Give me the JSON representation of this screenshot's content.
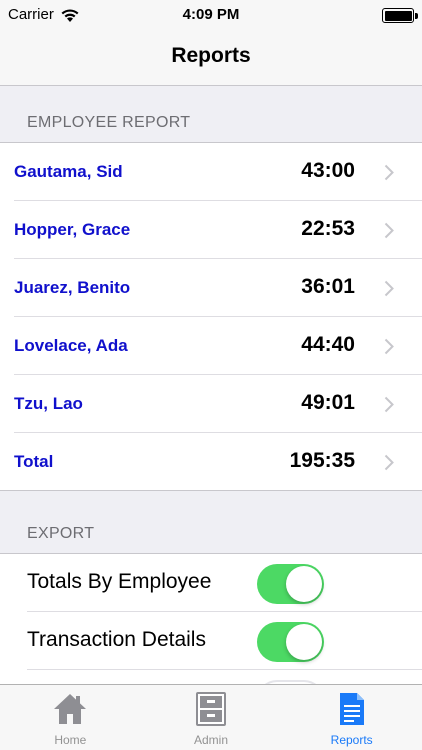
{
  "status_bar": {
    "carrier": "Carrier",
    "time": "4:09 PM"
  },
  "nav": {
    "title": "Reports"
  },
  "employee_report": {
    "header": "EMPLOYEE REPORT",
    "rows": [
      {
        "name": "Gautama, Sid",
        "value": "43:00"
      },
      {
        "name": "Hopper, Grace",
        "value": "22:53"
      },
      {
        "name": "Juarez, Benito",
        "value": "36:01"
      },
      {
        "name": "Lovelace, Ada",
        "value": "44:40"
      },
      {
        "name": "Tzu, Lao",
        "value": "49:01"
      },
      {
        "name": "Total",
        "value": "195:35"
      }
    ]
  },
  "export": {
    "header": "EXPORT",
    "rows": [
      {
        "label": "Totals By Employee",
        "enabled": true
      },
      {
        "label": "Transaction Details",
        "enabled": true
      }
    ]
  },
  "tab_bar": {
    "tabs": [
      {
        "label": "Home",
        "icon": "house-icon",
        "active": false
      },
      {
        "label": "Admin",
        "icon": "cabinet-icon",
        "active": false
      },
      {
        "label": "Reports",
        "icon": "document-icon",
        "active": true
      }
    ]
  },
  "colors": {
    "name_text": "#1010cc",
    "toggle_on": "#4cd964",
    "tab_active": "#1a7af8",
    "tab_inactive": "#929292",
    "background": "#efeff4"
  }
}
